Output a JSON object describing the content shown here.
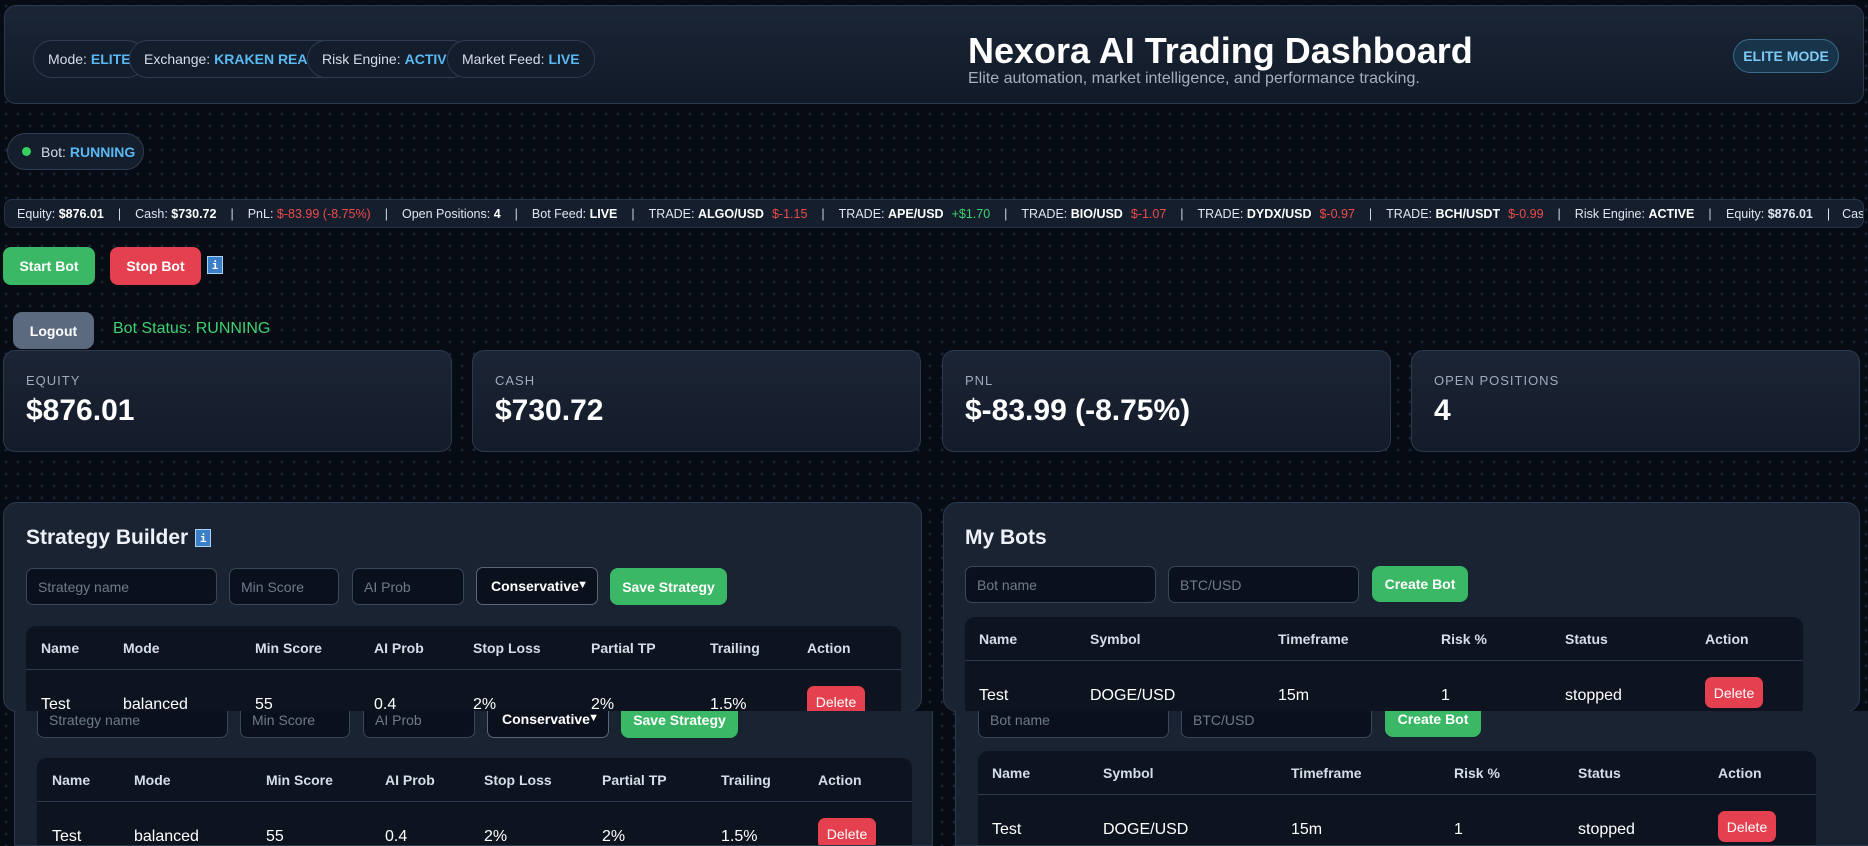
{
  "header": {
    "pills": [
      {
        "label": "Mode:",
        "value": "ELITE"
      },
      {
        "label": "Exchange:",
        "value": "KRAKEN READY"
      },
      {
        "label": "Risk Engine:",
        "value": "ACTIVE"
      },
      {
        "label": "Market Feed:",
        "value": "LIVE"
      }
    ],
    "title": "Nexora AI Trading Dashboard",
    "subtitle": "Elite automation, market intelligence, and performance tracking.",
    "mode_button": "ELITE MODE"
  },
  "bot_pill": {
    "label": "Bot:",
    "value": "RUNNING"
  },
  "ticker": {
    "items": [
      {
        "label": "Equity:",
        "value": "$876.01"
      },
      {
        "label": "Cash:",
        "value": "$730.72"
      },
      {
        "label": "PnL:",
        "value": "$-83.99 (-8.75%)"
      },
      {
        "label": "Open Positions:",
        "value": "4"
      },
      {
        "label": "Bot Feed:",
        "value": "LIVE"
      },
      {
        "label": "TRADE:",
        "value": "ALGO/USD",
        "change": "$-1.15"
      },
      {
        "label": "TRADE:",
        "value": "APE/USD",
        "change": "+$1.70"
      },
      {
        "label": "TRADE:",
        "value": "BIO/USD",
        "change": "$-1.07"
      },
      {
        "label": "TRADE:",
        "value": "DYDX/USD",
        "change": "$-0.97"
      },
      {
        "label": "TRADE:",
        "value": "BCH/USDT",
        "change": "$-0.99"
      },
      {
        "label": "Risk Engine:",
        "value": "ACTIVE"
      }
    ],
    "separator": "|",
    "repeat_equity_label": "Equity:",
    "repeat_equity_value": "$876.01",
    "repeat_cash_label": "Cash"
  },
  "controls": {
    "start": "Start Bot",
    "stop": "Stop Bot",
    "info_glyph": "i",
    "logout": "Logout",
    "bot_status": "Bot Status: RUNNING"
  },
  "stats": [
    {
      "label": "EQUITY",
      "value": "$876.01"
    },
    {
      "label": "CASH",
      "value": "$730.72"
    },
    {
      "label": "PNL",
      "value": "$-83.99 (-8.75%)"
    },
    {
      "label": "OPEN POSITIONS",
      "value": "4"
    }
  ],
  "strategy": {
    "title": "Strategy Builder",
    "name_placeholder": "Strategy name",
    "min_score_placeholder": "Min Score",
    "ai_prob_placeholder": "AI Prob",
    "mode_selected": "Conservative",
    "save_label": "Save Strategy",
    "columns": [
      "Name",
      "Mode",
      "Min Score",
      "AI Prob",
      "Stop Loss",
      "Partial TP",
      "Trailing",
      "Action"
    ],
    "rows": [
      {
        "name": "Test",
        "mode": "balanced",
        "min_score": "55",
        "ai_prob": "0.4",
        "stop_loss": "2%",
        "partial_tp": "2%",
        "trailing": "1.5%",
        "action": "Delete"
      }
    ]
  },
  "bots": {
    "title": "My Bots",
    "name_placeholder": "Bot name",
    "symbol_placeholder": "BTC/USD",
    "create_label": "Create Bot",
    "columns": [
      "Name",
      "Symbol",
      "Timeframe",
      "Risk %",
      "Status",
      "Action"
    ],
    "rows": [
      {
        "name": "Test",
        "symbol": "DOGE/USD",
        "timeframe": "15m",
        "risk": "1",
        "status": "stopped",
        "action": "Delete"
      }
    ]
  },
  "colors": {
    "accent_blue": "#5ab8f2",
    "success_green": "#3bb865",
    "danger_red": "#e5404f",
    "background": "#070b14"
  }
}
